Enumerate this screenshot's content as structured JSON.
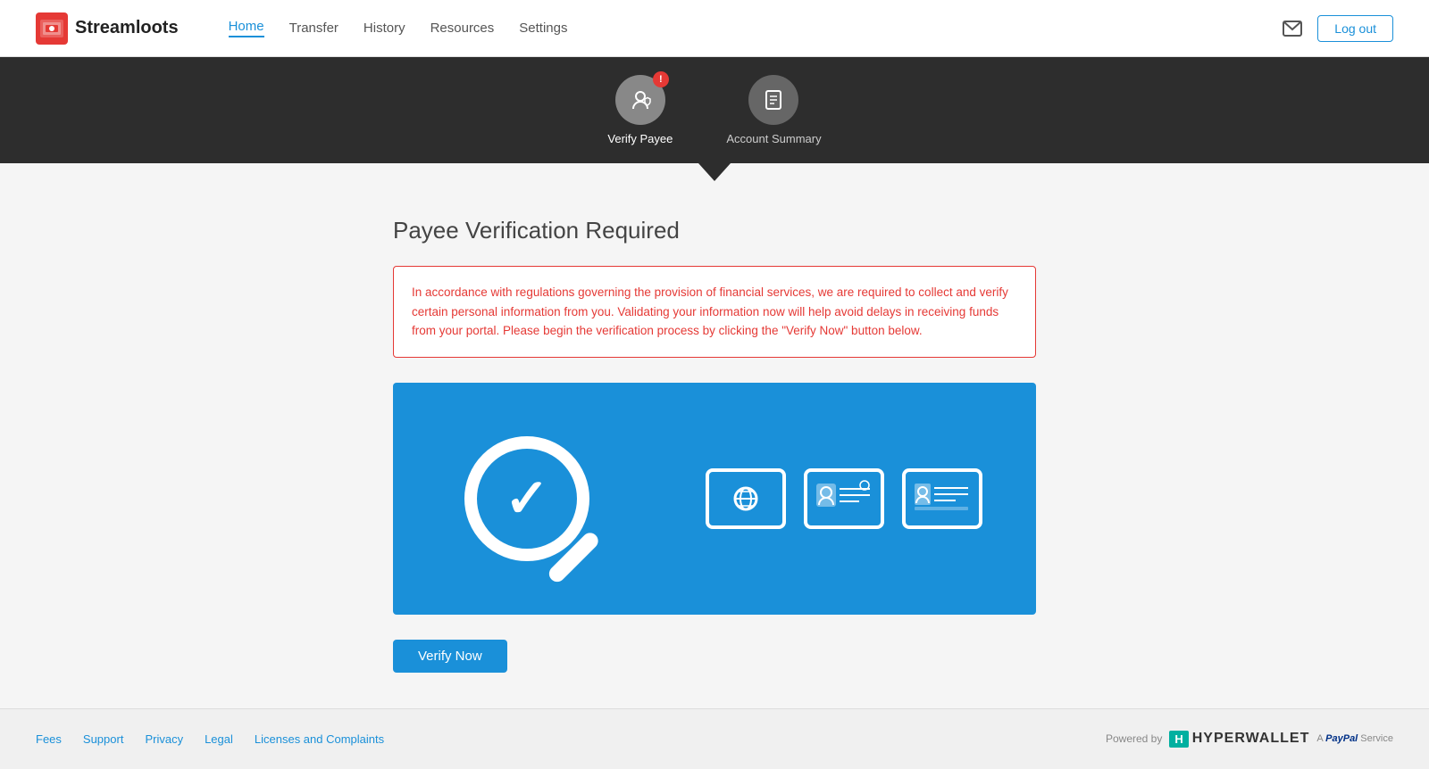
{
  "header": {
    "logo_text": "Streamloots",
    "nav": {
      "home": "Home",
      "transfer": "Transfer",
      "history": "History",
      "resources": "Resources",
      "settings": "Settings"
    },
    "mail_label": "Mail",
    "logout_label": "Log out"
  },
  "stepper": {
    "steps": [
      {
        "id": "verify-payee",
        "label": "Verify Payee",
        "active": true,
        "has_badge": true,
        "badge_text": "!"
      },
      {
        "id": "account-summary",
        "label": "Account Summary",
        "active": false,
        "has_badge": false
      }
    ]
  },
  "main": {
    "title": "Payee Verification Required",
    "alert": "In accordance with regulations governing the provision of financial services, we are required to collect and verify certain personal information from you. Validating your information now will help avoid delays in receiving funds from your portal. Please begin the verification process by clicking the \"Verify Now\" button below.",
    "verify_button_label": "Verify Now"
  },
  "footer": {
    "links": [
      {
        "label": "Fees",
        "href": "#"
      },
      {
        "label": "Support",
        "href": "#"
      },
      {
        "label": "Privacy",
        "href": "#"
      },
      {
        "label": "Legal",
        "href": "#"
      },
      {
        "label": "Licenses and Complaints",
        "href": "#"
      }
    ],
    "powered_by": "Powered by",
    "hw_box": "H",
    "hw_name": "HYPERWALLET",
    "paypal_line": "A PayPal Service"
  }
}
